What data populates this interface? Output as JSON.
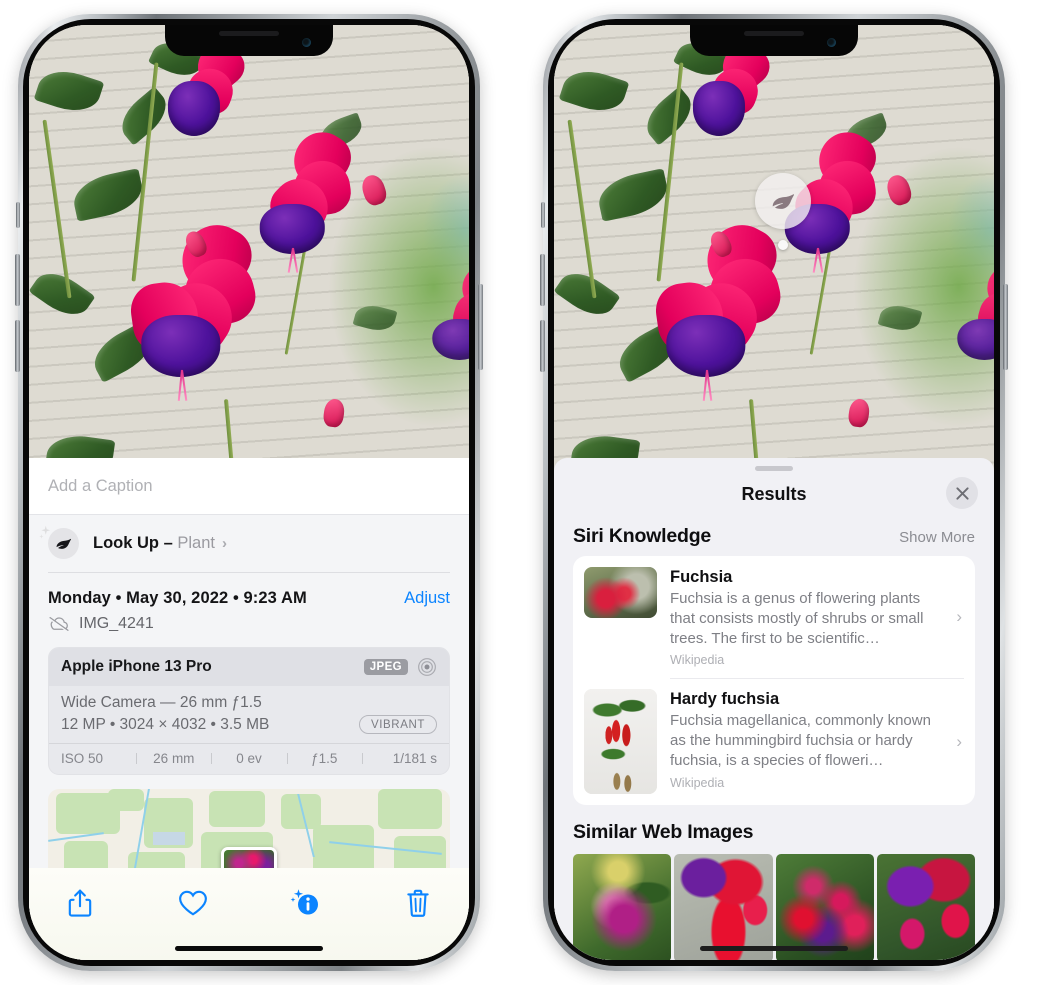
{
  "left_phone": {
    "caption": {
      "placeholder": "Add a Caption"
    },
    "lookup": {
      "label": "Look Up –",
      "subject": "Plant",
      "chevron": "›",
      "icon": "leaf-icon",
      "sparkle_icon": "sparkle-icon"
    },
    "date": {
      "text": "Monday • May 30, 2022 • 9:23 AM",
      "adjust_label": "Adjust"
    },
    "file": {
      "name": "IMG_4241",
      "icon": "cloud-slash-icon"
    },
    "exif": {
      "model": "Apple iPhone 13 Pro",
      "format_badge": "JPEG",
      "aperture_icon": "aperture-icon",
      "lens_line": "Wide Camera — 26 mm ƒ1.5",
      "specs_line": "12 MP • 3024 × 4032 • 3.5 MB",
      "style_badge": "VIBRANT",
      "settings": [
        "ISO 50",
        "26 mm",
        "0 ev",
        "ƒ1.5",
        "1/181 s"
      ]
    },
    "toolbar": [
      {
        "name": "share-button",
        "icon": "share-icon"
      },
      {
        "name": "favorite-button",
        "icon": "heart-icon"
      },
      {
        "name": "info-button",
        "icon": "info-sparkle-icon"
      },
      {
        "name": "delete-button",
        "icon": "trash-icon"
      }
    ]
  },
  "right_phone": {
    "visual_lookup_badge": {
      "icon": "leaf-icon"
    },
    "sheet": {
      "title": "Results",
      "close_icon": "close-icon",
      "grabber": "drag-handle"
    },
    "siri_knowledge": {
      "title": "Siri Knowledge",
      "show_more": "Show More",
      "items": [
        {
          "name": "Fuchsia",
          "description": "Fuchsia is a genus of flowering plants that consists mostly of shrubs or small trees. The first to be scientific…",
          "source": "Wikipedia",
          "chevron": "›"
        },
        {
          "name": "Hardy fuchsia",
          "description": "Fuchsia magellanica, commonly known as the hummingbird fuchsia or hardy fuchsia, is a species of floweri…",
          "source": "Wikipedia",
          "chevron": "›"
        }
      ]
    },
    "similar_web_images": {
      "title": "Similar Web Images",
      "tiles": [
        "fuchsia-pink-white",
        "fuchsia-red-closeup",
        "fuchsia-bush",
        "fuchsia-purple-red"
      ]
    }
  },
  "colors": {
    "accent_blue": "#0b84ff",
    "sheet_gray": "#f1f1f5",
    "card_white": "#ffffff",
    "text_primary": "#101012",
    "text_secondary": "#7e7f85"
  }
}
